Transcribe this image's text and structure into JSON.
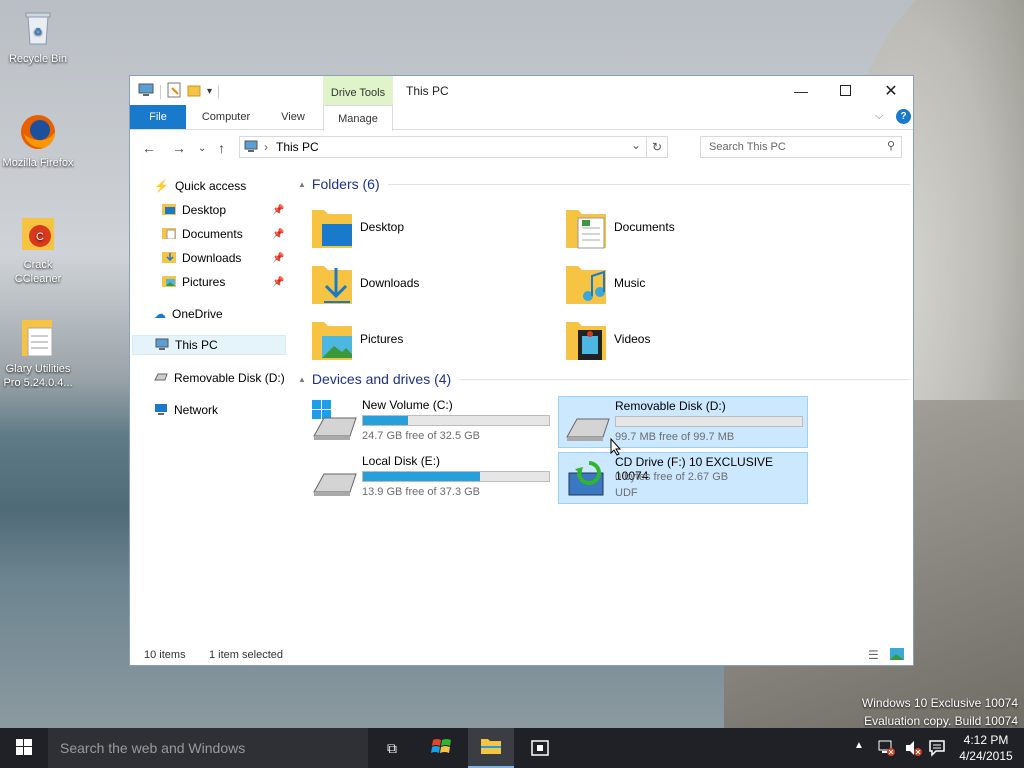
{
  "desktop": {
    "icons": [
      {
        "label": "Recycle Bin"
      },
      {
        "label": "Mozilla Firefox"
      },
      {
        "label": "Crack CCleaner"
      },
      {
        "label": "Glary Utilities Pro 5.24.0.4..."
      }
    ],
    "watermark_line1": "Windows 10 Exclusive 10074",
    "watermark_line2": "Evaluation copy. Build 10074"
  },
  "window": {
    "title": "This PC",
    "context_tab": "Drive Tools",
    "tabs": [
      "File",
      "Computer",
      "View",
      "Manage"
    ],
    "address": "This PC",
    "search_placeholder": "Search This PC",
    "help": "?"
  },
  "nav": {
    "quick_access": "Quick access",
    "pinned": [
      "Desktop",
      "Documents",
      "Downloads",
      "Pictures"
    ],
    "onedrive": "OneDrive",
    "this_pc": "This PC",
    "removable": "Removable Disk (D:)",
    "network": "Network"
  },
  "folders": {
    "header": "Folders (6)",
    "items": [
      "Desktop",
      "Documents",
      "Downloads",
      "Music",
      "Pictures",
      "Videos"
    ]
  },
  "devices": {
    "header": "Devices and drives (4)",
    "items": [
      {
        "name": "New Volume (C:)",
        "free": "24.7 GB free of 32.5 GB",
        "used_fraction": 0.24
      },
      {
        "name": "Removable Disk (D:)",
        "free": "99.7 MB free of 99.7 MB",
        "used_fraction": 0.0
      },
      {
        "name": "Local Disk (E:)",
        "free": "13.9 GB free of 37.3 GB",
        "used_fraction": 0.63
      },
      {
        "name": "CD Drive (F:) 10 EXCLUSIVE 10074",
        "free": "0 bytes free of 2.67 GB",
        "fs": "UDF"
      }
    ]
  },
  "status": {
    "items": "10 items",
    "selected": "1 item selected"
  },
  "taskbar": {
    "search_placeholder": "Search the web and Windows",
    "time": "4:12 PM",
    "date": "4/24/2015"
  },
  "colors": {
    "accent": "#1979ca",
    "bar_fill": "#26a0da",
    "selection": "#cce8ff",
    "header_text": "#1e3287"
  }
}
